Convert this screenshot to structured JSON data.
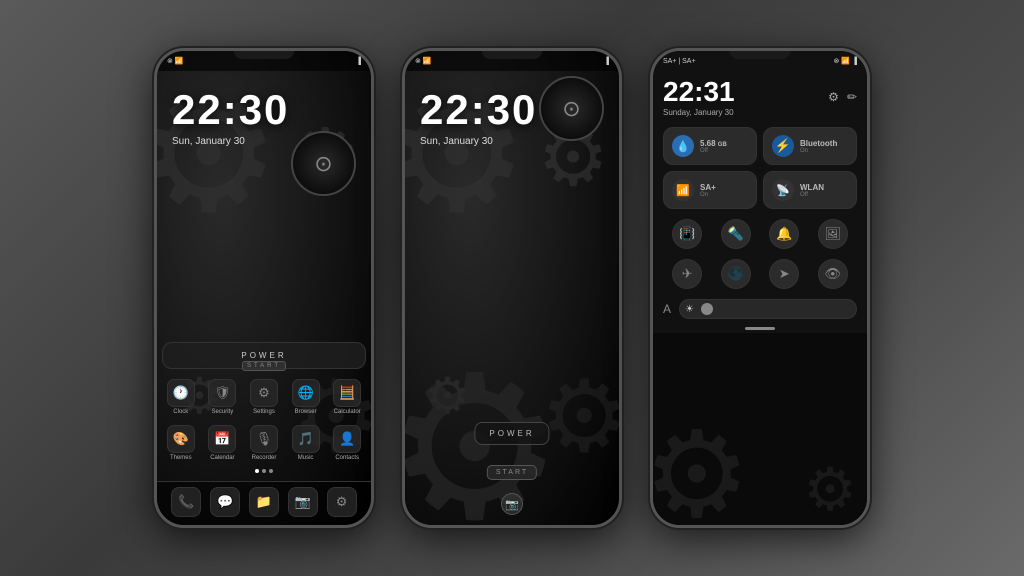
{
  "phones": {
    "phone1": {
      "statusBar": {
        "left": "📶",
        "right": "🔋"
      },
      "time": "22:30",
      "date": "Sun, January 30",
      "apps": [
        {
          "icon": "🕐",
          "label": "Clock"
        },
        {
          "icon": "🛡",
          "label": "Security"
        },
        {
          "icon": "⚙",
          "label": "Settings"
        },
        {
          "icon": "🌐",
          "label": "Browser"
        },
        {
          "icon": "🧮",
          "label": "Calculator"
        },
        {
          "icon": "🎨",
          "label": "Themes"
        },
        {
          "icon": "📅",
          "label": "Calendar"
        },
        {
          "icon": "🎙",
          "label": "Recorder"
        },
        {
          "icon": "🎵",
          "label": "Music"
        },
        {
          "icon": "👤",
          "label": "Contacts"
        }
      ],
      "dock": [
        "📞",
        "💬",
        "📁",
        "📷",
        "⚙"
      ],
      "powerLabel": "POWER",
      "startLabel": "START"
    },
    "phone2": {
      "time": "22:30",
      "date": "Sun, January 30",
      "powerLabel": "POWER",
      "startLabel": "START"
    },
    "phone3": {
      "statusBarLeft": "SA+ | SA+",
      "statusBarRight": "🔵🔋",
      "time": "22:31",
      "date": "Sunday, January 30",
      "tiles": [
        {
          "icon": "💧",
          "label": "5.68",
          "sub": "GB",
          "iconClass": "tile-blue"
        },
        {
          "icon": "🔵",
          "label": "Bluetooth",
          "sub": "On",
          "iconClass": "tile-blue2"
        },
        {
          "icon": "📶",
          "label": "SA+",
          "sub": "On",
          "iconClass": "tile-gray"
        },
        {
          "icon": "📶",
          "label": "WLAN",
          "sub": "Off",
          "iconClass": "tile-wifi"
        }
      ],
      "iconRow1": [
        "📳",
        "🔦",
        "🔔",
        "🖼"
      ],
      "iconRow2": [
        "✈",
        "🌑",
        "➤",
        "👁"
      ],
      "brightnessLabel": "A"
    }
  }
}
